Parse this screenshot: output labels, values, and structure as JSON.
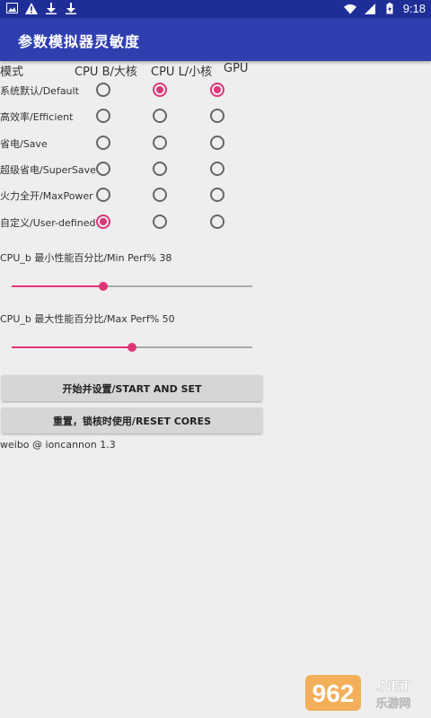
{
  "status_bar": {
    "time": "9:18",
    "left_icons": [
      "image-icon",
      "warning-icon",
      "download-icon",
      "download-icon"
    ],
    "right_icons": [
      "wifi-icon",
      "signal-icon",
      "battery-icon"
    ]
  },
  "app_bar": {
    "title": "参数模拟器灵敏度"
  },
  "grid": {
    "headers": {
      "mode": "模式",
      "cpu_b": "CPU B/大核",
      "cpu_l": "CPU L/小核",
      "gpu": "GPU"
    },
    "rows": [
      {
        "label": "系统默认/Default",
        "cpu_b": false,
        "cpu_l": true,
        "gpu": true
      },
      {
        "label": "高效率/Efficient",
        "cpu_b": false,
        "cpu_l": false,
        "gpu": false
      },
      {
        "label": "省电/Save",
        "cpu_b": false,
        "cpu_l": false,
        "gpu": false
      },
      {
        "label": "超级省电/SuperSave",
        "cpu_b": false,
        "cpu_l": false,
        "gpu": false
      },
      {
        "label": "火力全开/MaxPower",
        "cpu_b": false,
        "cpu_l": false,
        "gpu": false
      },
      {
        "label": "自定义/User-defined",
        "cpu_b": true,
        "cpu_l": false,
        "gpu": false
      }
    ]
  },
  "sliders": {
    "min_perf": {
      "label": "CPU_b 最小性能百分比/Min Perf% 38",
      "value": 38
    },
    "max_perf": {
      "label": "CPU_b 最大性能百分比/Max Perf% 50",
      "value": 50
    }
  },
  "buttons": {
    "start": "开始并设置/START AND SET",
    "reset": "重置，锁核时使用/RESET CORES"
  },
  "footer": "weibo @ ioncannon 1.3",
  "watermark": {
    "logo_text": "962",
    "net_text": ".NET",
    "sub_text": "乐游网"
  },
  "colors": {
    "status_bar": "#1f2e96",
    "app_bar": "#2f3fb0",
    "accent": "#e0357a",
    "background": "#eeeeee"
  }
}
